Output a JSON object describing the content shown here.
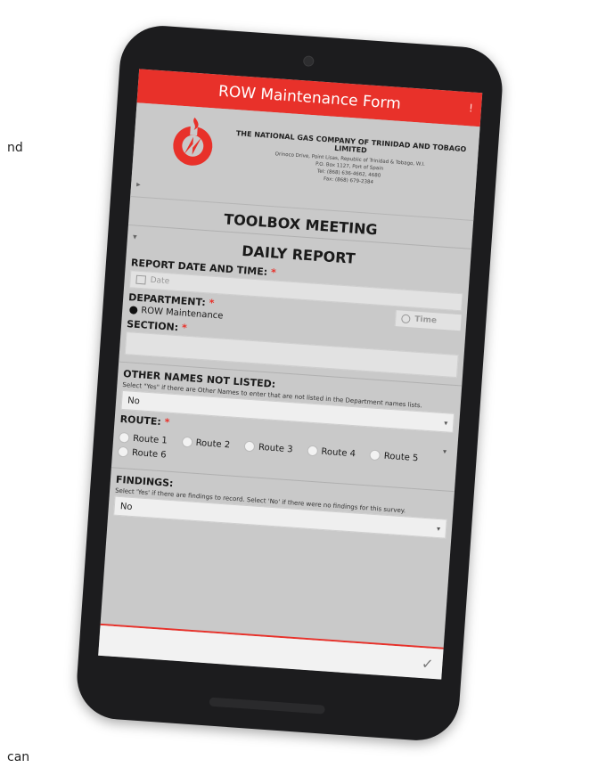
{
  "background": {
    "text_top": "nd",
    "text_bottom": "can"
  },
  "app": {
    "title": "ROW Maintenance Form"
  },
  "company": {
    "name": "THE NATIONAL GAS COMPANY OF TRINIDAD AND TOBAGO LIMITED",
    "address_lines": [
      "Orinoco Drive, Point Lisas, Republic of Trinidad & Tobago, W.I.",
      "P.O. Box 1127, Port of Spain",
      "Tel: (868) 636-4662, 4680",
      "Fax: (868) 679-2384"
    ]
  },
  "sections": {
    "toolbox": "TOOLBOX MEETING",
    "daily": "DAILY REPORT"
  },
  "fields": {
    "report_date": {
      "label": "REPORT DATE AND TIME:",
      "date_placeholder": "Date",
      "time_placeholder": "Time"
    },
    "department": {
      "label": "DEPARTMENT:",
      "value": "ROW Maintenance"
    },
    "section": {
      "label": "SECTION:"
    },
    "other_names": {
      "label": "OTHER NAMES NOT LISTED:",
      "hint": "Select \"Yes\" if there are Other Names to enter that are not listed in the Department names lists.",
      "value": "No"
    },
    "route": {
      "label": "ROUTE:",
      "options": [
        "Route 1",
        "Route 2",
        "Route 3",
        "Route 4",
        "Route 5",
        "Route 6"
      ]
    },
    "findings": {
      "label": "FINDINGS:",
      "hint": "Select 'Yes' if there are findings to record. Select 'No' if there were no findings for this survey.",
      "value": "No"
    }
  },
  "colors": {
    "accent": "#e8312a",
    "screen_bg": "#c9c9c9",
    "device": "#1c1c1e"
  },
  "icons": {
    "logo": "ngc-flame-logo",
    "calendar": "calendar-icon",
    "clock": "clock-icon",
    "submit": "checkmark-icon"
  }
}
